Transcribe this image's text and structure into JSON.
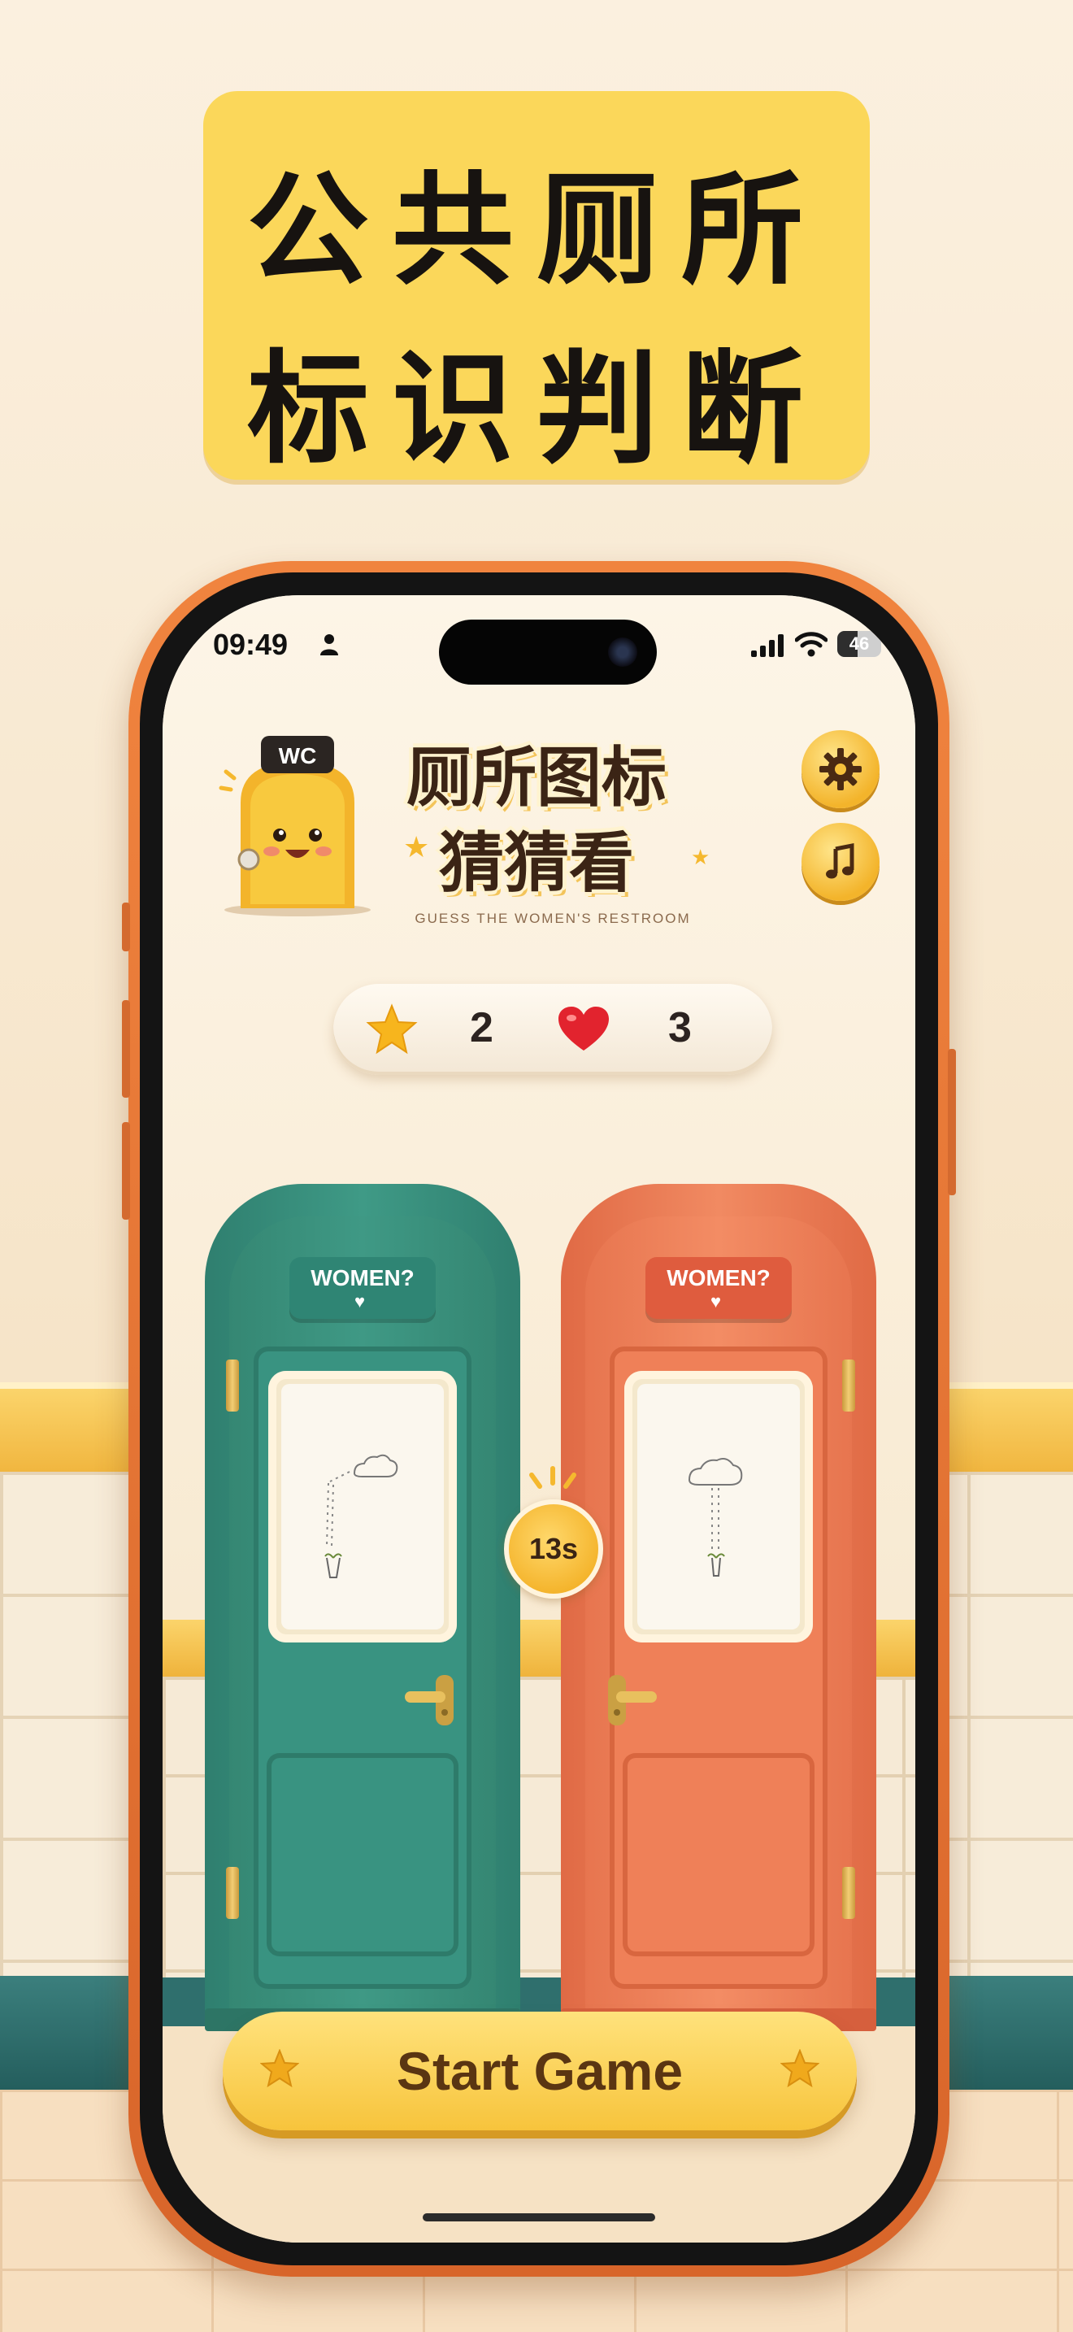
{
  "promo": {
    "headline_line1": "公共厕所",
    "headline_line2": "标识判断"
  },
  "status_bar": {
    "time": "09:49",
    "battery": "46"
  },
  "header": {
    "mascot_sign": "WC",
    "title_line1": "厕所图标",
    "title_line2": "猜猜看",
    "subtitle": "GUESS THE WOMEN'S RESTROOM"
  },
  "score": {
    "stars": "2",
    "lives": "3"
  },
  "doors": {
    "left_sign": "WOMEN?",
    "right_sign": "WOMEN?"
  },
  "timer": "13s",
  "start_button": "Start Game",
  "colors": {
    "accent": "#f7c43c",
    "left_door": "#3f9985",
    "right_door": "#f38c64",
    "title": "#3b2415"
  }
}
